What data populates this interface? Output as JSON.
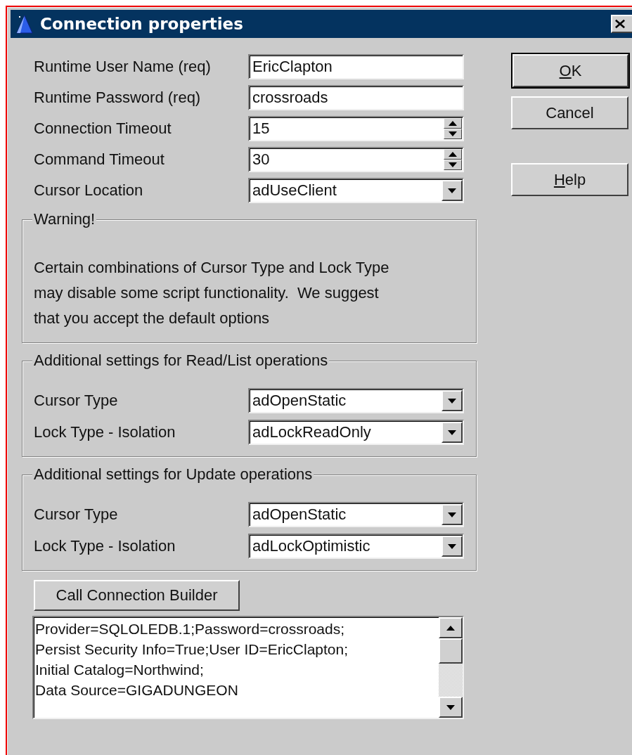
{
  "window": {
    "title": "Connection properties"
  },
  "fields": [
    {
      "label": "Runtime User Name (req)",
      "value": "EricClapton",
      "kind": "text"
    },
    {
      "label": "Runtime Password (req)",
      "value": "crossroads",
      "kind": "text"
    },
    {
      "label": "Connection Timeout",
      "value": "15",
      "kind": "spin"
    },
    {
      "label": "Command Timeout",
      "value": "30",
      "kind": "spin"
    },
    {
      "label": "Cursor Location",
      "value": "adUseClient",
      "kind": "dropdown"
    }
  ],
  "warning": {
    "title": "Warning!",
    "text": "Certain combinations of Cursor Type and Lock Type\nmay disable some script functionality.  We suggest\nthat you accept the default options"
  },
  "groups": [
    {
      "title": "Additional settings for Read/List operations",
      "fields": [
        {
          "label": "Cursor Type",
          "value": "adOpenStatic",
          "kind": "dropdown"
        },
        {
          "label": "Lock Type - Isolation",
          "value": "adLockReadOnly",
          "kind": "dropdown"
        }
      ]
    },
    {
      "title": "Additional settings for Update operations",
      "fields": [
        {
          "label": "Cursor Type",
          "value": "adOpenStatic",
          "kind": "dropdown"
        },
        {
          "label": "Lock Type - Isolation",
          "value": "adLockOptimistic",
          "kind": "dropdown"
        }
      ]
    }
  ],
  "builder_button": "Call Connection Builder",
  "connection_string": "Provider=SQLOLEDB.1;Password=crossroads;\nPersist Security Info=True;User ID=EricClapton;\nInitial Catalog=Northwind;\nData Source=GIGADUNGEON",
  "buttons": [
    {
      "label": "OK",
      "mnemonic_underlined": true,
      "default": true
    },
    {
      "label": "Cancel",
      "mnemonic_underlined": false,
      "default": false
    },
    {
      "label": "Help",
      "mnemonic_underlined": true,
      "default": false
    }
  ]
}
